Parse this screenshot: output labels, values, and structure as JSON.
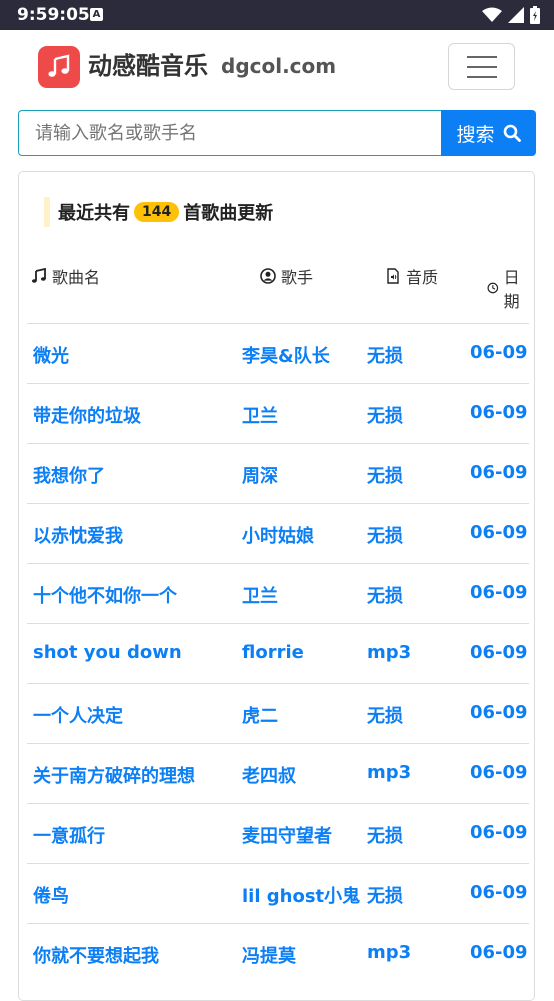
{
  "status_bar": {
    "time": "9:59:05",
    "sim_label": "A"
  },
  "navbar": {
    "brand_name": "动感酷音乐",
    "brand_domain": "dgcol.com"
  },
  "search": {
    "placeholder": "请输入歌名或歌手名",
    "button_label": "搜索"
  },
  "updates": {
    "title_prefix": "最近共有",
    "count": "144",
    "title_suffix": "首歌曲更新",
    "columns": {
      "song": "歌曲名",
      "artist": "歌手",
      "quality": "音质",
      "date": "日期"
    },
    "rows": [
      {
        "song": "微光",
        "artist": "李昊&队长",
        "quality": "无损",
        "date": "06-09"
      },
      {
        "song": "带走你的垃圾",
        "artist": "卫兰",
        "quality": "无损",
        "date": "06-09"
      },
      {
        "song": "我想你了",
        "artist": "周深",
        "quality": "无损",
        "date": "06-09"
      },
      {
        "song": "以赤忱爱我",
        "artist": "小时姑娘",
        "quality": "无损",
        "date": "06-09"
      },
      {
        "song": "十个他不如你一个",
        "artist": "卫兰",
        "quality": "无损",
        "date": "06-09"
      },
      {
        "song": "shot you down",
        "artist": "florrie",
        "quality": "mp3",
        "date": "06-09"
      },
      {
        "song": "一个人决定",
        "artist": "虎二",
        "quality": "无损",
        "date": "06-09"
      },
      {
        "song": "关于南方破碎的理想",
        "artist": "老四叔",
        "quality": "mp3",
        "date": "06-09"
      },
      {
        "song": "一意孤行",
        "artist": "麦田守望者",
        "quality": "无损",
        "date": "06-09"
      },
      {
        "song": "倦鸟",
        "artist": "lil ghost小鬼",
        "quality": "无损",
        "date": "06-09"
      },
      {
        "song": "你就不要想起我",
        "artist": "冯提莫",
        "quality": "mp3",
        "date": "06-09"
      }
    ]
  },
  "colors": {
    "accent": "#0d7ff5",
    "logo": "#ef4a4a",
    "badge": "#ffc107",
    "statusbar": "#2b2b3b"
  },
  "icons": [
    "music-note-icon",
    "user-circle-icon",
    "audio-file-icon",
    "clock-icon",
    "search-icon",
    "menu-icon",
    "wifi-icon",
    "signal-icon",
    "battery-icon"
  ]
}
